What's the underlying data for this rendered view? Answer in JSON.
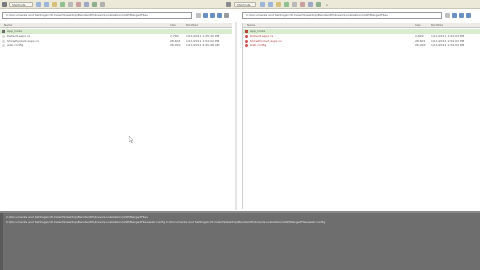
{
  "toolbar": {
    "left_dropdown": "Shortcuts",
    "right_dropdown": "Shortcuts",
    "zoom_label": "x"
  },
  "left_panel": {
    "path": "C:\\Documents and Settings\\cdt.Indent\\Desktop\\Bandwidth\\bravo\\Localization\\ASP\\MergedFiles",
    "columns": [
      "Name",
      "Size",
      "Modified"
    ],
    "rows": [
      {
        "name": "App_Code",
        "size": "",
        "modified": "",
        "type": "folder"
      },
      {
        "name": "Default.aspx.cs",
        "size": "2,790",
        "modified": "1/11/2011 1:25:30 PM",
        "type": "file"
      },
      {
        "name": "ShowProduct.aspx.cs",
        "size": "28,601",
        "modified": "1/11/2011 1:54:02 PM",
        "type": "file"
      },
      {
        "name": "web.config",
        "size": "26,000",
        "modified": "1/11/2011 9:45:48 AM",
        "type": "file"
      }
    ]
  },
  "right_panel": {
    "path": "C:\\Documents and Settings\\cdt.Indent\\Desktop\\Bandwidth\\bravo\\Localization\\ASP\\MergedFiles",
    "columns": [
      "Name",
      "Size",
      "Modified"
    ],
    "rows": [
      {
        "name": "App_Code",
        "size": "",
        "modified": "",
        "type": "folder"
      },
      {
        "name": "Default.aspx.cs",
        "size": "2,820",
        "modified": "1/11/2011 1:54:04 PM",
        "type": "file"
      },
      {
        "name": "ShowProduct.aspx.cs",
        "size": "28,601",
        "modified": "1/11/2011 1:54:04 PM",
        "type": "file"
      },
      {
        "name": "web.config",
        "size": "26,000",
        "modified": "1/11/2011 1:54:04 PM",
        "type": "file"
      }
    ]
  },
  "log": {
    "lines": [
      "C:\\Documents and Settings\\cdt.Indent\\Desktop\\Bandwidth\\bravo\\Localization\\ASP\\MergedFiles",
      "C:\\Documents and Settings\\cdt.Indent\\Desktop\\Bandwidth\\bravo\\Localization\\ASP\\MergedFiles\\web.config  C:\\Documents and Settings\\cdt.Indent\\Desktop\\Bandwidth\\bravo\\Localization\\ASP\\MergedFiles\\web.config"
    ]
  },
  "colors": {
    "selected_row": "#d8ecd0",
    "log_background": "#6e6e6e",
    "file_icon": "#d25252"
  }
}
